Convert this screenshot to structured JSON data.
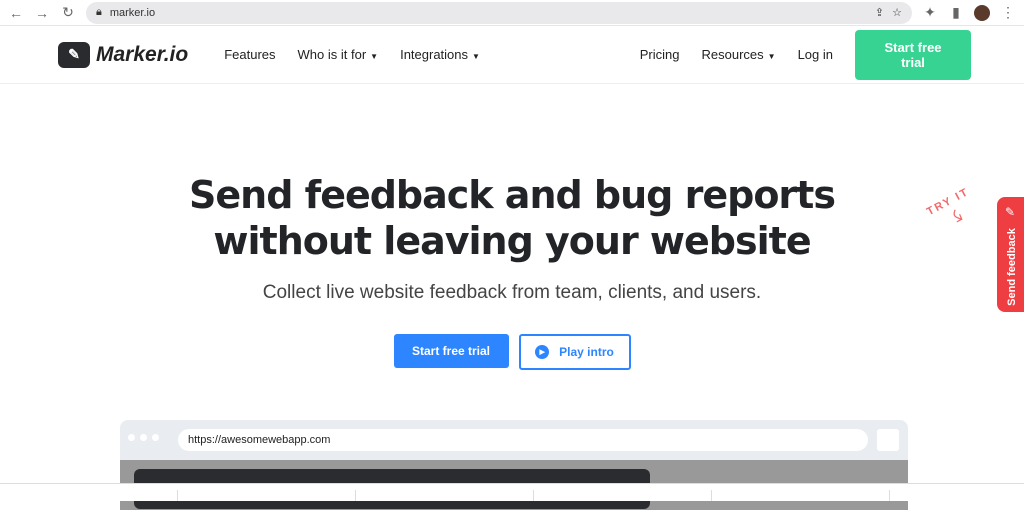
{
  "browser": {
    "url": "marker.io"
  },
  "nav": {
    "logo": "Marker.io",
    "features": "Features",
    "who": "Who is it for",
    "integrations": "Integrations",
    "pricing": "Pricing",
    "resources": "Resources",
    "login": "Log in",
    "cta": "Start free trial"
  },
  "hero": {
    "title_line1": "Send feedback and bug reports",
    "title_line2": "without leaving your website",
    "subtitle": "Collect live website feedback from team, clients, and users.",
    "primary": "Start free trial",
    "secondary": "Play intro"
  },
  "mockup": {
    "url": "https://awesomewebapp.com"
  },
  "widget": {
    "try": "TRY IT",
    "label": "Send feedback"
  },
  "colors": {
    "green": "#36d392",
    "blue": "#2d86ff",
    "red": "#ef3e42"
  }
}
